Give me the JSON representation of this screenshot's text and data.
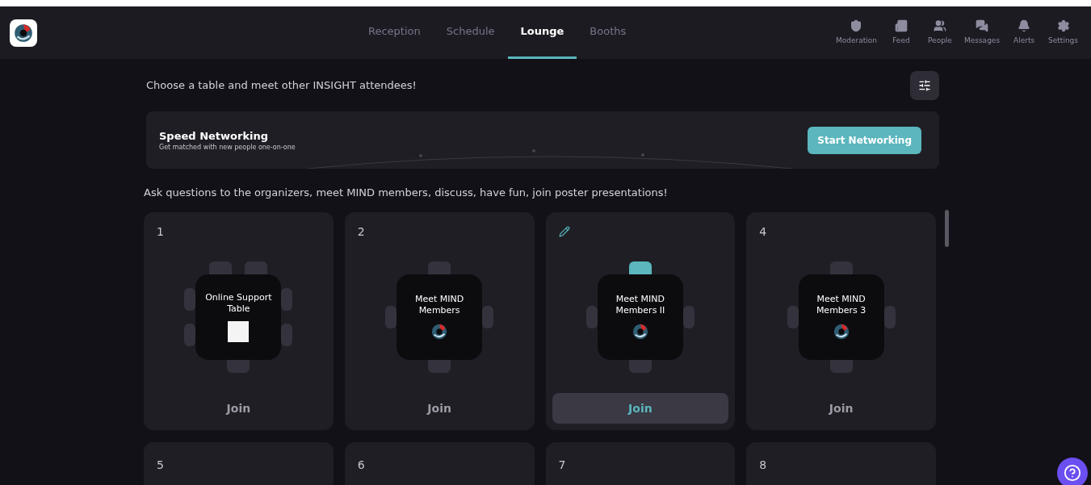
{
  "header": {
    "tabs": [
      {
        "label": "Reception",
        "selected": false
      },
      {
        "label": "Schedule",
        "selected": false
      },
      {
        "label": "Lounge",
        "selected": true
      },
      {
        "label": "Booths",
        "selected": false
      }
    ],
    "nav": [
      {
        "label": "Moderation",
        "kind": "shield"
      },
      {
        "label": "Feed",
        "kind": "feed"
      },
      {
        "label": "People",
        "kind": "people"
      },
      {
        "label": "Messages",
        "kind": "messages"
      },
      {
        "label": "Alerts",
        "kind": "bell"
      },
      {
        "label": "Settings",
        "kind": "gear"
      }
    ]
  },
  "intro": "Choose a table and meet other INSIGHT attendees!",
  "speed_networking": {
    "title": "Speed Networking",
    "subtitle": "Get matched with new people one-on-one",
    "button": "Start Networking"
  },
  "tables_intro": "Ask questions to the organizers, meet MIND members, discuss, have fun, join poster presentations!",
  "tables": [
    {
      "number": "1",
      "name": "Online Support Table",
      "kind": "photo",
      "selected": false,
      "join": "Join",
      "seats": {
        "top": [
          false,
          false
        ],
        "left": [
          false,
          false
        ],
        "right": [
          false,
          false
        ],
        "bottom": [
          false
        ]
      }
    },
    {
      "number": "2",
      "name": "Meet MIND Members",
      "kind": "logo",
      "selected": false,
      "join": "Join",
      "seats": {
        "top": [
          false
        ],
        "left": [
          false
        ],
        "right": [
          false
        ],
        "bottom": [
          false
        ]
      }
    },
    {
      "name": "Meet MIND Members II",
      "kind": "logo",
      "selected": true,
      "join": "Join",
      "seats": {
        "top": [
          true
        ],
        "left": [
          false
        ],
        "right": [
          false
        ],
        "bottom": [
          false
        ]
      }
    },
    {
      "number": "4",
      "name": "Meet MIND Members 3",
      "kind": "logo",
      "selected": false,
      "join": "Join",
      "seats": {
        "top": [
          false
        ],
        "left": [
          false
        ],
        "right": [
          false
        ],
        "bottom": [
          false
        ]
      }
    },
    {
      "number": "5"
    },
    {
      "number": "6"
    },
    {
      "number": "7"
    },
    {
      "number": "8"
    }
  ]
}
